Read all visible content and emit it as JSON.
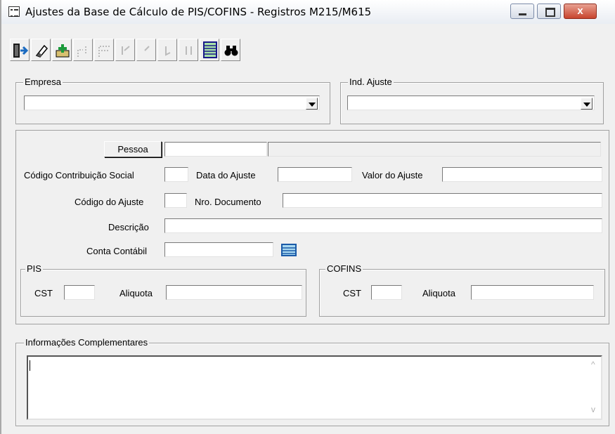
{
  "window": {
    "title": "Ajustes da Base de Cálculo de PIS/COFINS - Registros M215/M615",
    "close_label": "x"
  },
  "toolbar": {
    "buttons": [
      {
        "name": "exit-icon"
      },
      {
        "name": "eraser-icon"
      },
      {
        "name": "add-icon"
      },
      {
        "name": "edit-icon"
      },
      {
        "name": "delete-icon"
      },
      {
        "name": "first-record-icon"
      },
      {
        "name": "prev-record-icon"
      },
      {
        "name": "next-record-icon"
      },
      {
        "name": "last-record-icon"
      },
      {
        "name": "list-icon"
      },
      {
        "name": "binoculars-icon"
      }
    ]
  },
  "empresa": {
    "legend": "Empresa",
    "value": ""
  },
  "ind_ajuste": {
    "legend": "Ind. Ajuste",
    "value": ""
  },
  "form": {
    "pessoa_button": "Pessoa",
    "pessoa_code": "",
    "pessoa_name": "",
    "codigo_contribuicao_label": "Código Contribuição Social",
    "codigo_contribuicao_value": "",
    "data_ajuste_label": "Data do Ajuste",
    "data_ajuste_value": "",
    "valor_ajuste_label": "Valor do Ajuste",
    "valor_ajuste_value": "",
    "codigo_ajuste_label": "Código do Ajuste",
    "codigo_ajuste_value": "",
    "nro_documento_label": "Nro. Documento",
    "nro_documento_value": "",
    "descricao_label": "Descrição",
    "descricao_value": "",
    "conta_contabil_label": "Conta Contábil",
    "conta_contabil_value": ""
  },
  "pis": {
    "legend": "PIS",
    "cst_label": "CST",
    "cst_value": "",
    "aliquota_label": "Aliquota",
    "aliquota_value": ""
  },
  "cofins": {
    "legend": "COFINS",
    "cst_label": "CST",
    "cst_value": "",
    "aliquota_label": "Aliquota",
    "aliquota_value": ""
  },
  "info": {
    "legend": "Informações Complementares",
    "value": ""
  },
  "scrollbar": {
    "up": "^",
    "down": "v"
  }
}
